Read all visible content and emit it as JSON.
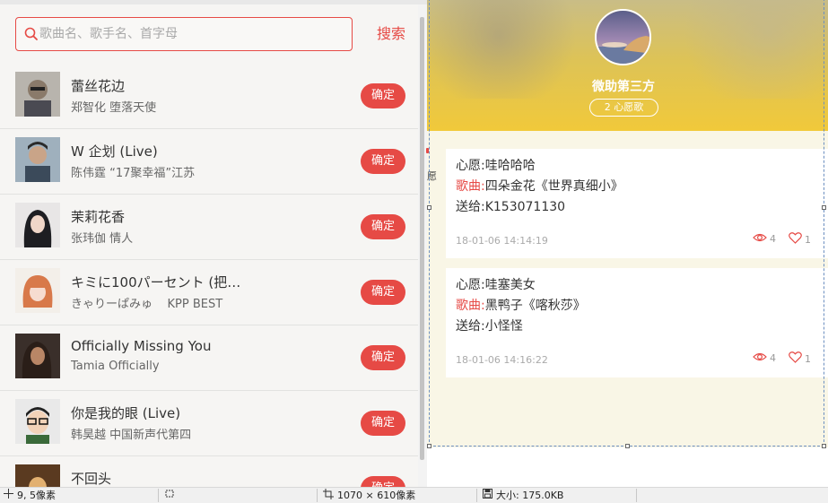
{
  "search": {
    "placeholder": "歌曲名、歌手名、首字母",
    "button_label": "搜索"
  },
  "songs": [
    {
      "title": "蕾丝花边",
      "artist": "郑智化 堕落天使",
      "button": "确定"
    },
    {
      "title": "W 企划 (Live)",
      "artist": "陈伟霆 “17聚幸福”江苏",
      "button": "确定"
    },
    {
      "title": "茉莉花香",
      "artist": "张玮伽 情人",
      "button": "确定"
    },
    {
      "title": "キミに100パーセント (把…",
      "artist": "きゃりーぱみゅ    KPP BEST",
      "button": "确定"
    },
    {
      "title": "Officially Missing You",
      "artist": "Tamia Officially",
      "button": "确定"
    },
    {
      "title": "你是我的眼 (Live)",
      "artist": "韩昊越 中国新声代第四",
      "button": "确定"
    },
    {
      "title": "不回头",
      "artist": "",
      "button": "确定"
    }
  ],
  "profile": {
    "username": "微助第三方",
    "wish_count": "2 心愿歌"
  },
  "wishes": [
    {
      "wish_label": "心愿:",
      "wish_text": "哇哈哈哈",
      "song_label": "歌曲:",
      "song_text": "四朵金花《世界真细小》",
      "to_label": "送给:",
      "to_text": "K153071130",
      "time": "18-01-06 14:14:19",
      "views": "4",
      "likes": "1"
    },
    {
      "wish_label": "心愿:",
      "wish_text": "哇塞美女",
      "song_label": "歌曲:",
      "song_text": "黑鸭子《喀秋莎》",
      "to_label": "送给:",
      "to_text": "小怪怪",
      "time": "18-01-06 14:16:22",
      "views": "4",
      "likes": "1"
    }
  ],
  "side_fragment": "愿",
  "statusbar": {
    "cursor_pos": "9, 5像素",
    "canvas_size": "1070 × 610像素",
    "file_size": "大小: 175.0KB"
  },
  "colors": {
    "accent": "#e64a45",
    "hero_yellow": "#f1c93a",
    "content_bg": "#f9f6e6"
  },
  "icons": [
    "search-icon",
    "eye-icon",
    "heart-icon",
    "crosshair-icon",
    "selection-icon",
    "crop-icon",
    "save-icon"
  ]
}
